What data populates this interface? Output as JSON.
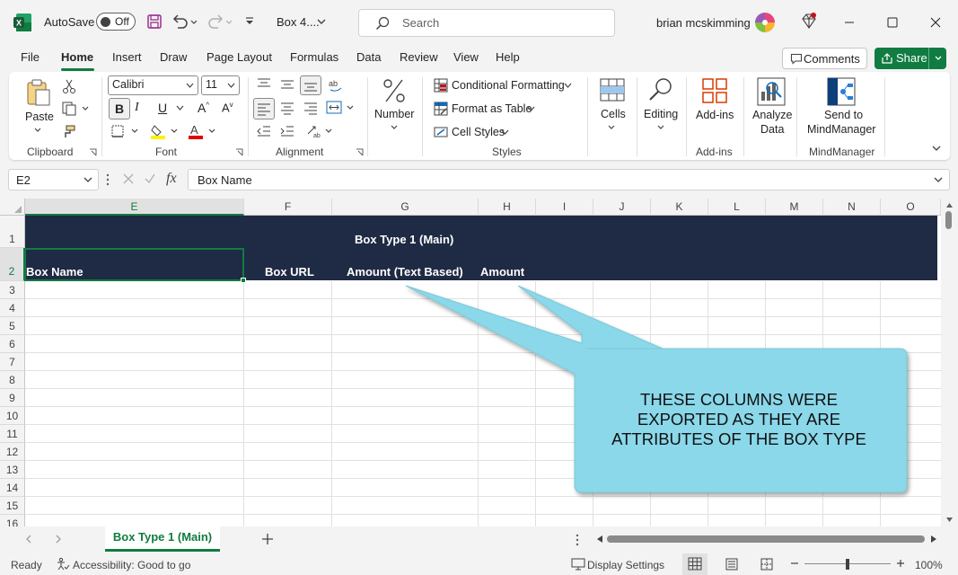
{
  "titlebar": {
    "autosave_label": "AutoSave",
    "autosave_state": "Off",
    "filename": "Box 4....",
    "search_placeholder": "Search",
    "user_name": "brian mcskimming"
  },
  "menu": {
    "tabs": [
      "File",
      "Home",
      "Insert",
      "Draw",
      "Page Layout",
      "Formulas",
      "Data",
      "Review",
      "View",
      "Help"
    ],
    "active_tab": "Home",
    "comments_label": "Comments",
    "share_label": "Share"
  },
  "ribbon": {
    "clipboard": {
      "paste_label": "Paste",
      "group_label": "Clipboard"
    },
    "font": {
      "font_name": "Calibri",
      "font_size": "11",
      "group_label": "Font"
    },
    "alignment": {
      "group_label": "Alignment"
    },
    "number": {
      "label": "Number"
    },
    "styles": {
      "conditional_formatting": "Conditional Formatting",
      "format_as_table": "Format as Table",
      "cell_styles": "Cell Styles",
      "group_label": "Styles"
    },
    "cells": {
      "label": "Cells"
    },
    "editing": {
      "label": "Editing"
    },
    "addins": {
      "label": "Add-ins",
      "group_label": "Add-ins"
    },
    "analyze": {
      "label_line1": "Analyze",
      "label_line2": "Data"
    },
    "mindmanager": {
      "label_line1": "Send to",
      "label_line2": "MindManager",
      "group_label": "MindManager"
    }
  },
  "formula_bar": {
    "name_box": "E2",
    "fx_label": "fx",
    "content": "Box Name"
  },
  "grid": {
    "columns": [
      "E",
      "F",
      "G",
      "H",
      "I",
      "J",
      "K",
      "L",
      "M",
      "N",
      "O"
    ],
    "selected_column": "E",
    "rows": [
      "1",
      "2",
      "3",
      "4",
      "5",
      "6",
      "7",
      "8",
      "9",
      "10",
      "11",
      "12",
      "13",
      "14",
      "15",
      "16"
    ],
    "selected_row": "2",
    "row1_title": "Box Type 1 (Main)",
    "row2_headers": {
      "E": "Box Name",
      "F": "Box URL",
      "G": "Amount (Text Based)",
      "H": "Amount"
    },
    "header_band_color": "#1f2a44",
    "accent_color": "#107c41"
  },
  "callout": {
    "lines": [
      "THESE COLUMNS WERE",
      "EXPORTED AS THEY ARE",
      "ATTRIBUTES OF THE BOX TYPE"
    ],
    "fill_color": "#8ad8ea"
  },
  "sheets": {
    "tabs": [
      "Box Type 1 (Main)"
    ],
    "active": "Box Type 1 (Main)"
  },
  "statusbar": {
    "mode": "Ready",
    "accessibility": "Accessibility: Good to go",
    "display_settings": "Display Settings",
    "zoom": "100%"
  }
}
